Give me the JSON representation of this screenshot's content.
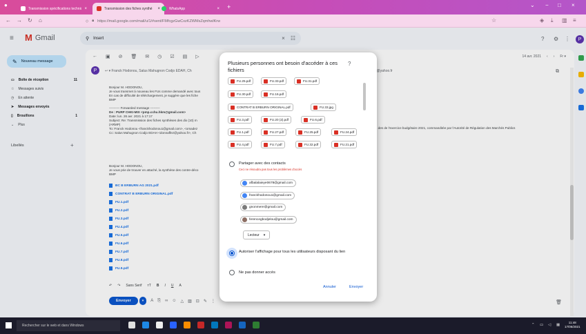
{
  "browser": {
    "tabs": [
      {
        "label": "Transmission spécifications technique",
        "active": false
      },
      {
        "label": "Transmission des fiches synthé",
        "active": true
      },
      {
        "label": "WhatsApp",
        "active": false
      }
    ],
    "url": "https://mail.google.com/mail/u/1/#sent/FMfcgzGwCxzKZWMsZqmhwlKrw"
  },
  "gmail": {
    "product_name": "Gmail",
    "search_value": "Insert",
    "compose_label": "Nouveau message",
    "sidebar": [
      {
        "label": "Boîte de réception",
        "count": "11",
        "bold": true
      },
      {
        "label": "Messages suivis",
        "count": "",
        "bold": false
      },
      {
        "label": "En attente",
        "count": "",
        "bold": false
      },
      {
        "label": "Messages envoyés",
        "count": "",
        "bold": true
      },
      {
        "label": "Brouillons",
        "count": "1",
        "bold": true
      },
      {
        "label": "Plus",
        "count": "",
        "bold": false
      }
    ],
    "labels_heading": "Libellés",
    "user_initial": "P",
    "mail": {
      "date": "14 avr. 2021",
      "sender_initial": "P",
      "recipients": "Franck Hodonou, Salus Mahugnon Codjo EDAH, Ch",
      "recipients_right": "dg@yahoo.fr",
      "body_lines": [
        "Bonjour M. HODONOU,",
        "Je vous transmet à nouveau les FUs comme demandé avec tous",
        "En cas de difficulté de téléchargement, je suggère que les fiche",
        "BMP",
        "---------- Forwarded message ---------",
        "De : PURP CHKI-MIX <pmp.cchu.hkm@gmail.com>",
        "Date: lun. 26 avr. 2021 à 17:17",
        "Subject: Re: Transmission des fiches synthèses des dix (10) m",
        "(ARMP)",
        "To: Franck Hodonou <franckhodonou1@gmail.com>, <omadez",
        "Cc: Salus Mahugnon Codjo EDAH <donnaffez@yahoo.fr>, Ch"
      ],
      "body_right_line": "s des de l'exercice budgétaire 2021, commanditée par l'Autorité de Régulation des Marchés Publics",
      "body2_lines": [
        "Bonjour M. HODONOU,",
        "Je vous prie de trouver en attaché, la synthèse des contre-déco",
        "BMP"
      ],
      "attachments": [
        "BC B ERBURN AG 2021.pdf",
        "CONTRAT B ERBURN ORIGINAL.pdf",
        "FU.1.pdf",
        "FU.2.pdf",
        "FU.3.pdf",
        "FU.4.pdf",
        "FU.5.pdf",
        "FU.6.pdf",
        "FU.7.pdf",
        "FU.8.pdf",
        "FU.9.pdf"
      ],
      "font_label": "Sans Serif",
      "send_label": "Envoyer"
    }
  },
  "dialog": {
    "title": "Plusieurs personnes ont besoin d'accéder à ces fichiers",
    "files": [
      "FU.25.pdf",
      "FU.33.pdf",
      "FU.31.pdf",
      "FU.30.pdf",
      "FU.16.pdf",
      "CONTRAT B ERBURN ORIGINAL.pdf",
      "FU.33.jpg",
      "FU.3.pdf",
      "FU.20 (2).pdf",
      "FU.6.pdf",
      "FU.1.pdf",
      "FU.27.pdf",
      "FU.25.pdf",
      "FU.24.pdf",
      "FU.4.pdf",
      "FU.7.pdf",
      "FU.32.pdf",
      "FU.21.pdf"
    ],
    "option_share_contacts": "Partager avec des contacts",
    "share_warning": "Ceci ne résoudra pas tous les problèmes d'accès",
    "contacts": [
      "afbalalaieye0678@gmail.com",
      "franckhodonou1@gmail.com",
      "gnonmere@gmail.com",
      "ferencegbodjelou@gmail.com"
    ],
    "role_label": "Lecteur",
    "option_allow_all": "Autoriser l'affichage pour tous les utilisateurs disposant du lien",
    "option_no_access": "Ne pas donner accès",
    "cancel_label": "Annuler",
    "send_label": "Envoyer"
  },
  "taskbar": {
    "search_placeholder": "Rechercher sur le web et dans Windows",
    "time": "11:48",
    "date": "17/06/2021"
  },
  "colors": {
    "accent": "#0b57d0",
    "pdf_red": "#d93025",
    "compose_bg": "#c2e7ff",
    "tab_gradient_start": "#d94c9b"
  }
}
